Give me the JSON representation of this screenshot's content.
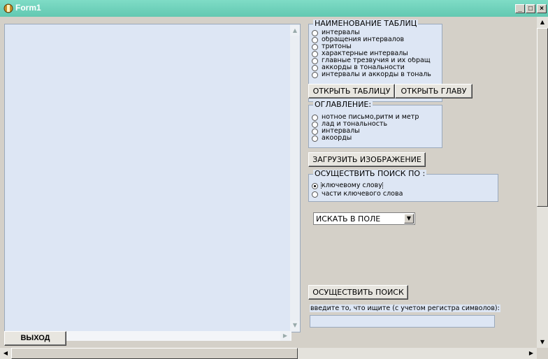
{
  "window": {
    "title": "Form1",
    "min": "_",
    "max": "□",
    "close": "×"
  },
  "tables_group": {
    "title": "НАИМЕНОВАНИЕ ТАБЛИЦ",
    "options": [
      "интервалы",
      "обращения интервалов",
      "тритоны",
      "характерные интервалы",
      "главные трезвучия и их обращ",
      "аккорды в тональности",
      "интервалы и аккорды в тональ"
    ]
  },
  "buttons": {
    "open_table": "ОТКРЫТЬ ТАБЛИЦУ",
    "open_chapter": "ОТКРЫТЬ ГЛАВУ",
    "load_image": "ЗАГРУЗИТЬ ИЗОБРАЖЕНИЕ",
    "search": "ОСУЩЕСТВИТЬ ПОИСК",
    "exit": "ВЫХОД"
  },
  "contents_group": {
    "title": "ОГЛАВЛЕНИЕ:",
    "options": [
      "нотное письмо,ритм и метр",
      "лад и тональность",
      "интервалы",
      "акоорды"
    ]
  },
  "search_group": {
    "title": "ОСУЩЕСТВИТЬ ПОИСК ПО :",
    "options": [
      "ключевому слову",
      "части ключевого слова"
    ],
    "selected": 0
  },
  "field_select": {
    "value": "ИСКАТЬ В ПОЛЕ"
  },
  "search_hint": "введите то, что ищите (с учетом регистра символов):",
  "search_input": {
    "value": ""
  }
}
